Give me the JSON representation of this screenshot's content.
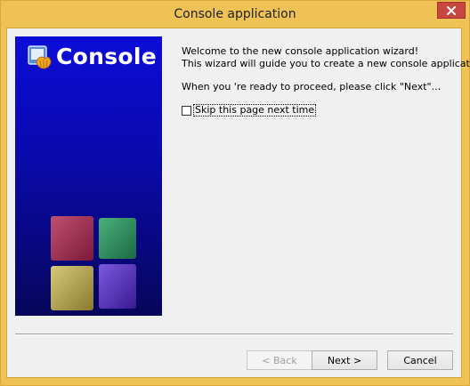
{
  "window": {
    "title": "Console application"
  },
  "side_panel": {
    "heading": "Console"
  },
  "content": {
    "welcome": "Welcome to the new console application wizard!",
    "guide": "This wizard will guide you to create a new console application.",
    "proceed": "When you 're ready to proceed, please click \"Next\"...",
    "skip_label": "Skip this page next time",
    "skip_checked": false
  },
  "buttons": {
    "back": "< Back",
    "next": "Next >",
    "cancel": "Cancel"
  },
  "colors": {
    "titlebar": "#eec255",
    "panel_blue": "#0c0cd8",
    "close_red": "#c7463f"
  },
  "icons": [
    "console-logo-icon",
    "close-icon",
    "colored-cubes-graphic"
  ]
}
